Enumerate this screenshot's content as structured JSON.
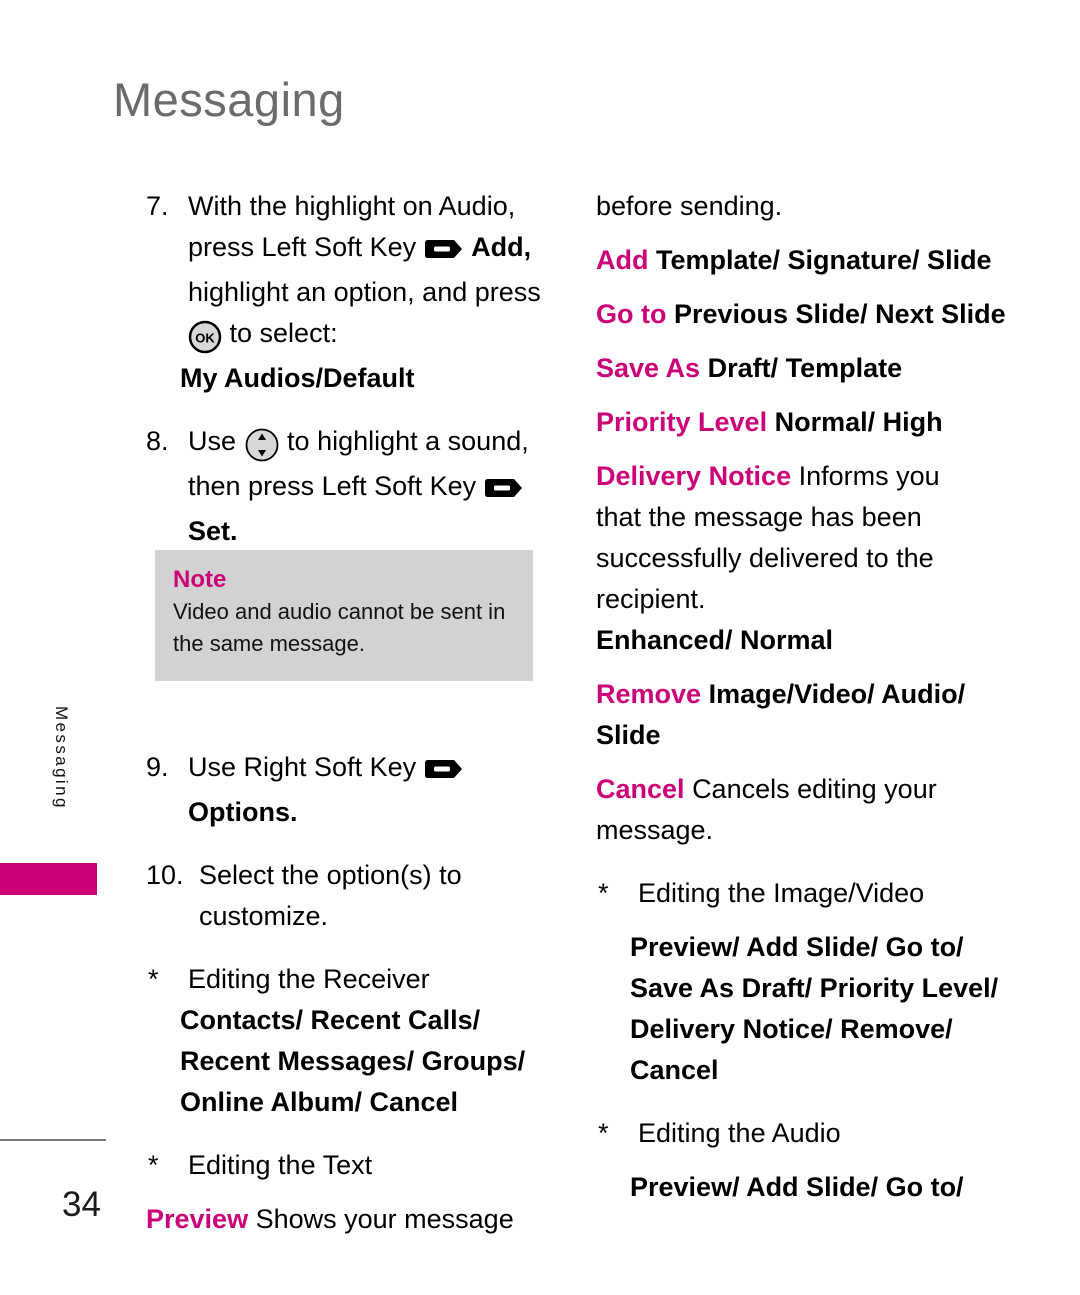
{
  "header": {
    "title": "Messaging"
  },
  "side_tab": {
    "label": "Messaging",
    "color": "#cc0077"
  },
  "footer": {
    "page_number": "34"
  },
  "icons": {
    "soft_key": "soft-key-icon",
    "ok_key": "ok-key-icon",
    "nav_key": "navigation-key-icon",
    "ok_label": "OK"
  },
  "colors": {
    "accent": "#cc0077",
    "header_gray": "#6b6b6b",
    "note_bg": "#d2d2d2"
  },
  "left_column": {
    "step7": {
      "number": "7.",
      "line1": "With the highlight on Audio,",
      "line2a": "press Left Soft Key",
      "line2b": "Add,",
      "line3": "highlight an option, and press",
      "line4": "to select:",
      "bold_result": "My Audios/Default"
    },
    "step8": {
      "number": "8.",
      "line1a": "Use",
      "line1b": "to highlight a sound,",
      "line2": "then press Left Soft Key",
      "bold_result": "Set."
    },
    "note": {
      "title": "Note",
      "text": "Video and audio cannot be sent in the same message."
    },
    "step9": {
      "number": "9.",
      "line1": "Use Right Soft Key",
      "bold_result": "Options."
    },
    "step10": {
      "number": "10.",
      "line1": "Select the option(s) to",
      "line2": "customize."
    },
    "bullet_receiver": {
      "star": "*",
      "label": "Editing the Receiver",
      "options_line1": "Contacts/ Recent Calls/",
      "options_line2": "Recent Messages/ Groups/",
      "options_line3": "Online Album/ Cancel"
    },
    "bullet_text": {
      "star": "*",
      "label": "Editing the Text"
    },
    "preview_entry": {
      "keyword": "Preview",
      "description": "Shows your message"
    }
  },
  "right_column": {
    "continued": "before sending.",
    "entries": [
      {
        "keyword": "Add",
        "description": "Template/ Signature/ Slide"
      },
      {
        "keyword": "Go to",
        "description": "Previous Slide/ Next Slide"
      },
      {
        "keyword": "Save As",
        "description": "Draft/ Template"
      },
      {
        "keyword": "Priority Level",
        "description": "Normal/ High"
      }
    ],
    "delivery_notice": {
      "keyword": "Delivery Notice",
      "line1": "Informs you",
      "line2": "that the message has been",
      "line3": "successfully delivered to the",
      "line4": "recipient.",
      "options": "Enhanced/ Normal"
    },
    "remove": {
      "keyword": "Remove",
      "description_line1": "Image/Video/ Audio/",
      "description_line2": "Slide"
    },
    "cancel": {
      "keyword": "Cancel",
      "line1": "Cancels editing your",
      "line2": "message."
    },
    "bullet_image_video": {
      "star": "*",
      "label": "Editing the Image/Video",
      "options_line1": "Preview/ Add Slide/ Go to/",
      "options_line2": "Save As Draft/ Priority Level/",
      "options_line3": "Delivery Notice/ Remove/",
      "options_line4": "Cancel"
    },
    "bullet_audio": {
      "star": "*",
      "label": "Editing the Audio",
      "options_line1": "Preview/ Add Slide/ Go to/"
    }
  }
}
